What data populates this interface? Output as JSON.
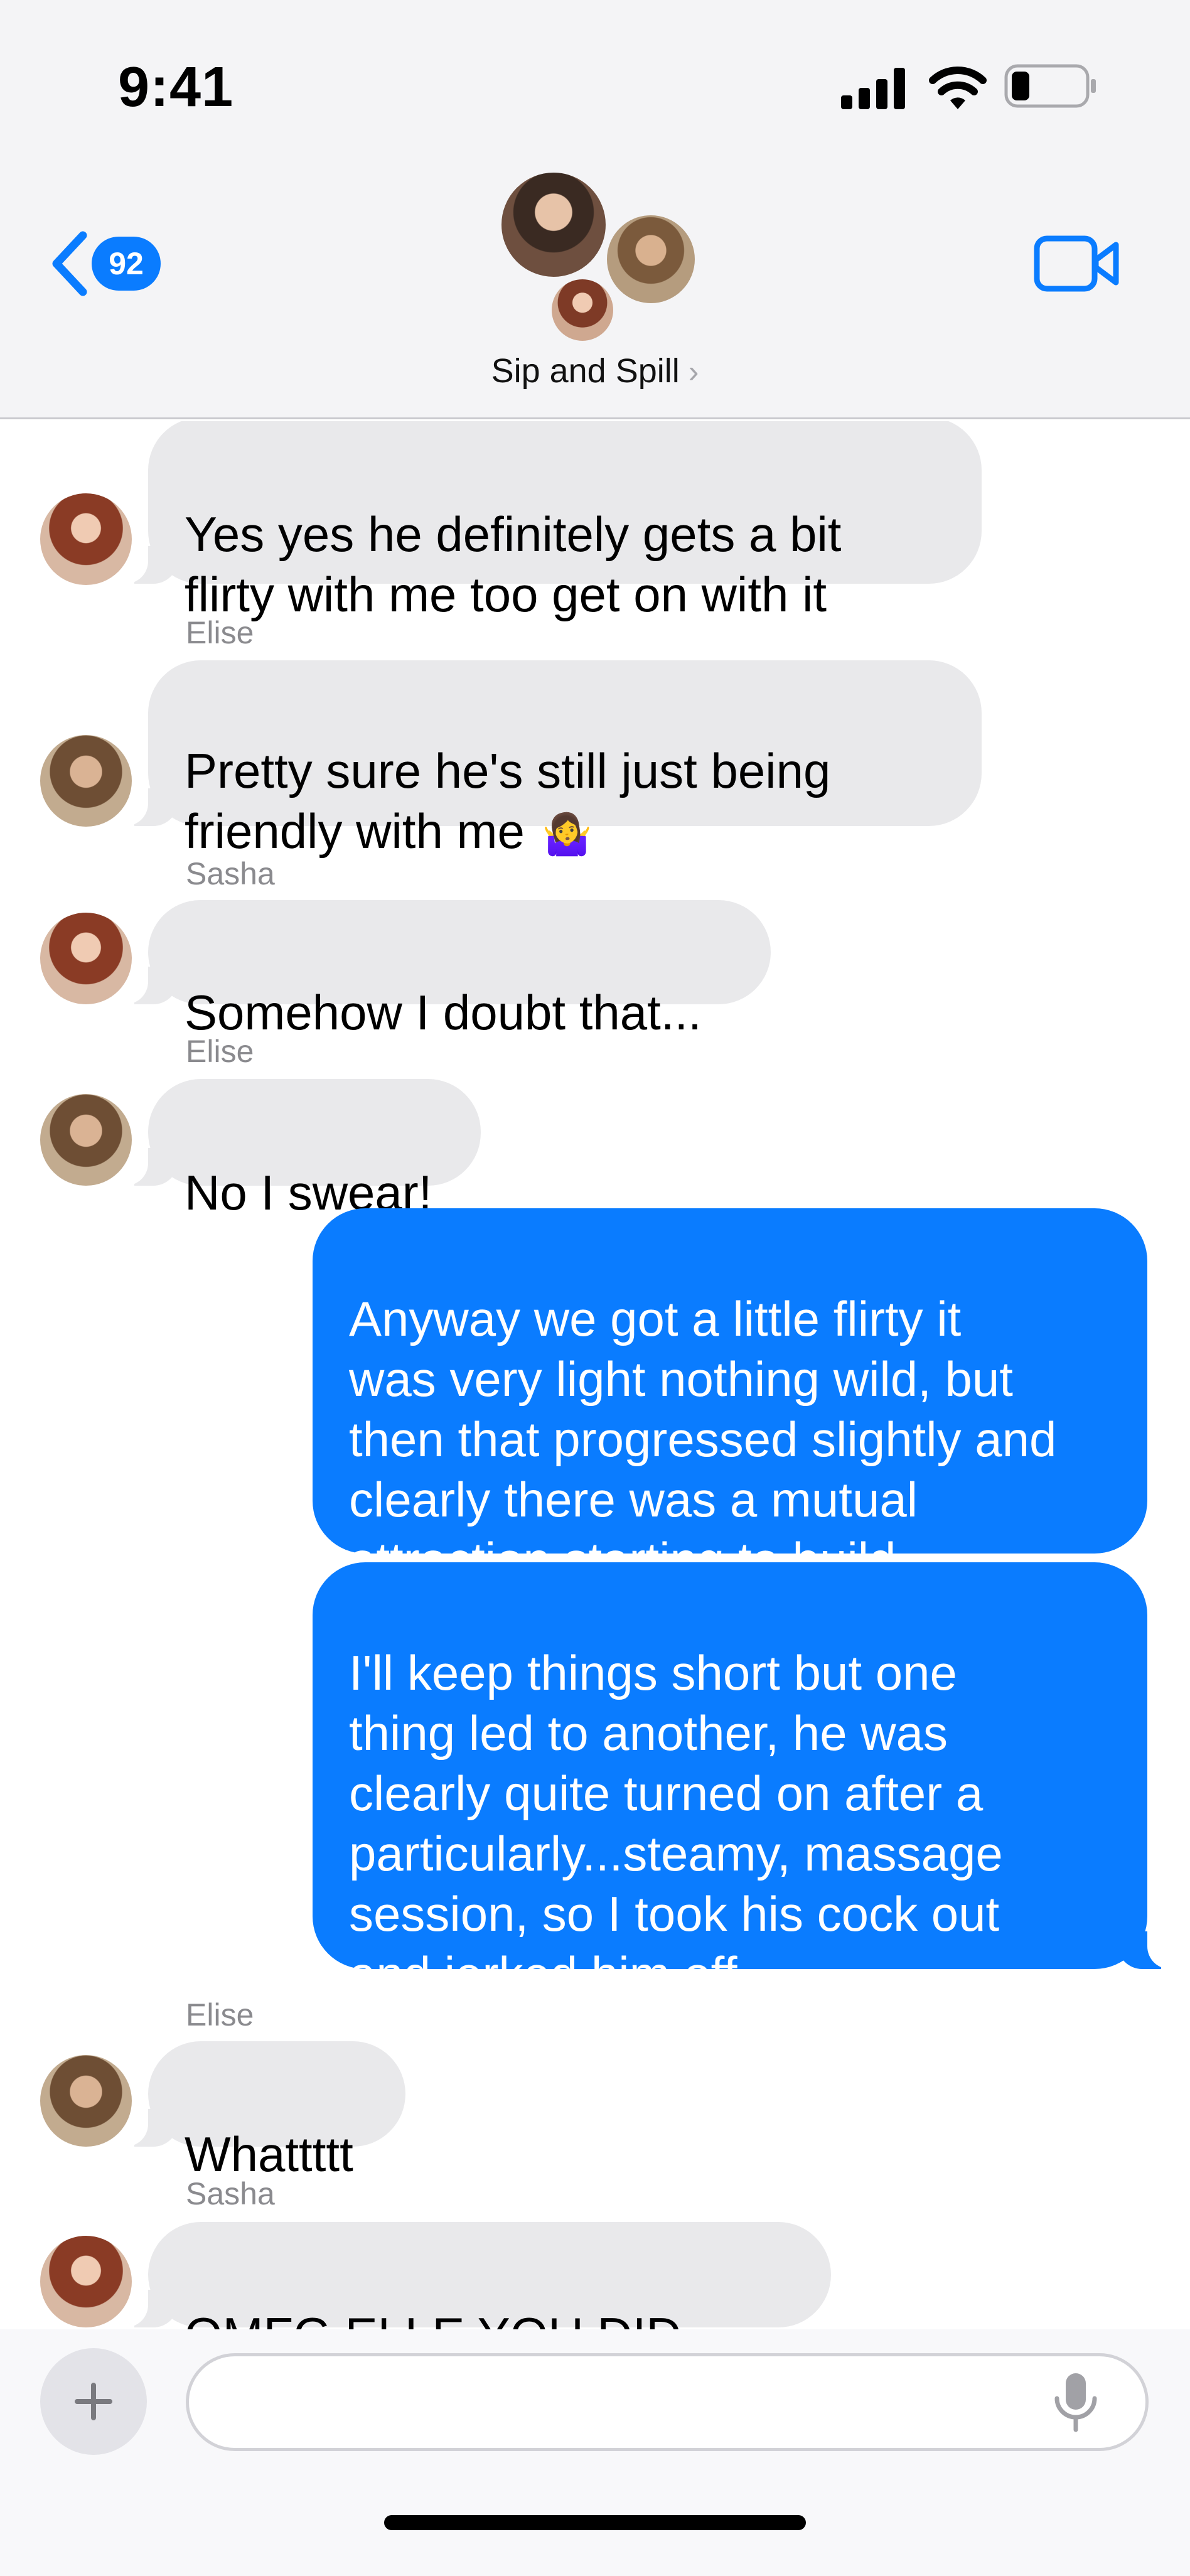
{
  "status_bar": {
    "time": "9:41",
    "icons": [
      "signal-icon",
      "wifi-icon",
      "battery-icon"
    ]
  },
  "header": {
    "back_icon": "chevron-left-icon",
    "unread_count": "92",
    "group_name": "Sip and Spill",
    "group_name_chevron": "›",
    "video_icon": "video-camera-icon"
  },
  "colors": {
    "accent": "#0a7cff",
    "incoming_bubble": "#e9e9eb",
    "header_bg": "#f4f4f6",
    "sender_label": "#8a8a8e"
  },
  "messages": [
    {
      "direction": "in",
      "sender": "Sasha",
      "show_sender": false,
      "text": "Yes yes he definitely gets a bit\nflirty with me too get on with it"
    },
    {
      "direction": "in",
      "sender": "Elise",
      "show_sender": true,
      "text": "Pretty sure he's still just being\nfriendly with me",
      "emoji": "🤷‍♀️"
    },
    {
      "direction": "in",
      "sender": "Sasha",
      "show_sender": true,
      "text": "Somehow I doubt that..."
    },
    {
      "direction": "in",
      "sender": "Elise",
      "show_sender": true,
      "text": "No I swear!"
    },
    {
      "direction": "out",
      "text": "Anyway we got a little flirty it\nwas very light nothing wild, but\nthen that progressed slightly and\nclearly there was a mutual\nattraction starting to build"
    },
    {
      "direction": "out",
      "text": "I'll keep things short but one\nthing led to another, he was\nclearly quite turned on after a\nparticularly...steamy, massage\nsession, so I took his cock out\nand jerked him off"
    },
    {
      "direction": "in",
      "sender": "Elise",
      "show_sender": true,
      "text": "Whattttt"
    },
    {
      "direction": "in",
      "sender": "Sasha",
      "show_sender": true,
      "text": "OMFG ELLE YOU DID NOT"
    }
  ],
  "composer": {
    "plus_icon": "plus-icon",
    "placeholder": "",
    "value": "",
    "mic_icon": "microphone-icon"
  }
}
